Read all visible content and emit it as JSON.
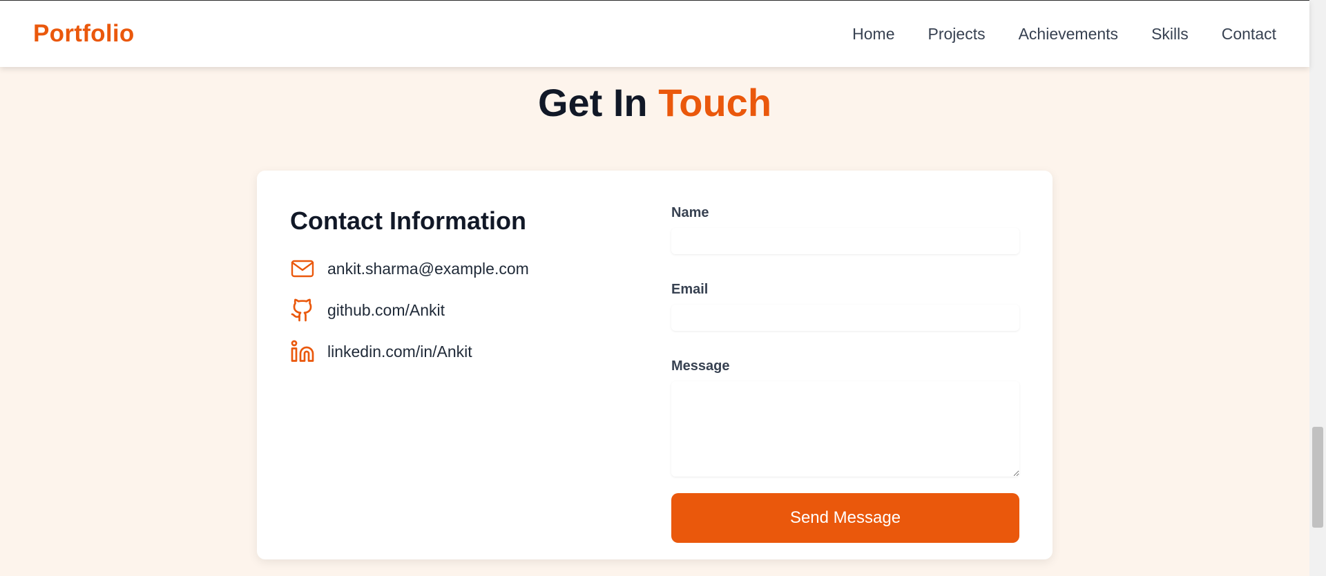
{
  "nav": {
    "brand": "Portfolio",
    "links": [
      "Home",
      "Projects",
      "Achievements",
      "Skills",
      "Contact"
    ]
  },
  "section": {
    "title_main": "Get In",
    "title_accent": "Touch"
  },
  "contact_info": {
    "heading": "Contact Information",
    "items": [
      {
        "icon": "mail-icon",
        "text": "ankit.sharma@example.com"
      },
      {
        "icon": "github-icon",
        "text": "github.com/Ankit"
      },
      {
        "icon": "linkedin-icon",
        "text": "linkedin.com/in/Ankit"
      }
    ]
  },
  "form": {
    "name_label": "Name",
    "name_value": "",
    "email_label": "Email",
    "email_value": "",
    "message_label": "Message",
    "message_value": "",
    "submit_label": "Send Message"
  },
  "colors": {
    "accent": "#ea580c",
    "background": "#fdf4ec",
    "text_dark": "#111827"
  }
}
